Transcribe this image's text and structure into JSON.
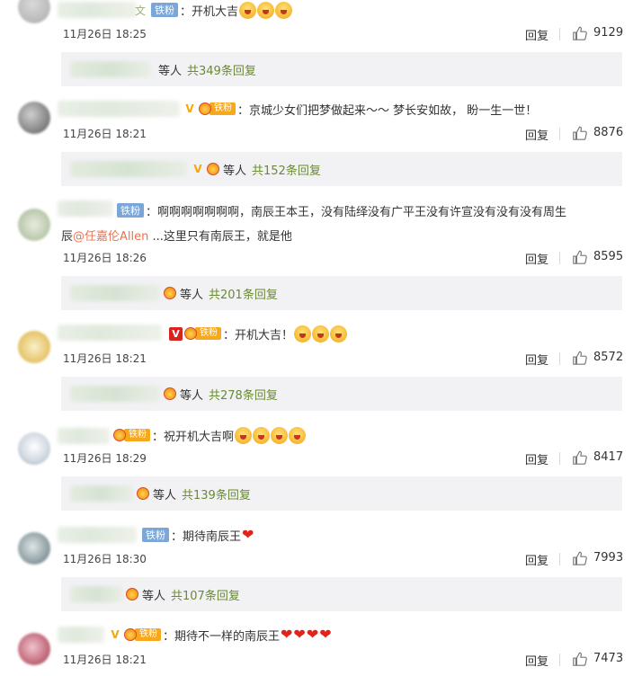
{
  "labels": {
    "reply": "回复",
    "etc": "等人",
    "tiefen": "铁粉",
    "vip": "V"
  },
  "colors": {
    "link_green": "#6a8a32",
    "mention_orange": "#eb7350",
    "fan_badge": "#f7a81b",
    "tiefen_badge": "#7aa7d8",
    "heart_red": "#e2231a"
  },
  "comments": [
    {
      "text": "：开机大吉",
      "emoji_count": 3,
      "hearts": 0,
      "date": "11月26日 18:25",
      "likes": "9129",
      "replies_total": "共349条回复"
    },
    {
      "text": "：京城少女们把梦做起来～～ 梦长安如故， 盼一生一世！",
      "emoji_count": 0,
      "hearts": 0,
      "date": "11月26日 18:21",
      "likes": "8876",
      "replies_total": "共152条回复"
    },
    {
      "text": "：啊啊啊啊啊啊啊，南辰王本王，没有陆绎没有广平王没有许宣没有没有没有周生",
      "text_line2_prefix": "辰",
      "mention": "@任嘉伦Allen",
      "text_line2_suffix": " ...这里只有南辰王，就是他",
      "date": "11月26日 18:26",
      "likes": "8595",
      "replies_total": "共201条回复"
    },
    {
      "text": "：开机大吉！",
      "emoji_count": 3,
      "hearts": 0,
      "date": "11月26日 18:21",
      "likes": "8572",
      "replies_total": "共278条回复"
    },
    {
      "text": "：祝开机大吉啊",
      "emoji_count": 4,
      "hearts": 0,
      "date": "11月26日 18:29",
      "likes": "8417",
      "replies_total": "共139条回复"
    },
    {
      "text": "：期待南辰王",
      "emoji_count": 0,
      "hearts": 1,
      "date": "11月26日 18:30",
      "likes": "7993",
      "replies_total": "共107条回复"
    },
    {
      "text": "：期待不一样的南辰王",
      "emoji_count": 0,
      "hearts": 4,
      "date": "11月26日 18:21",
      "likes": "7473"
    }
  ]
}
